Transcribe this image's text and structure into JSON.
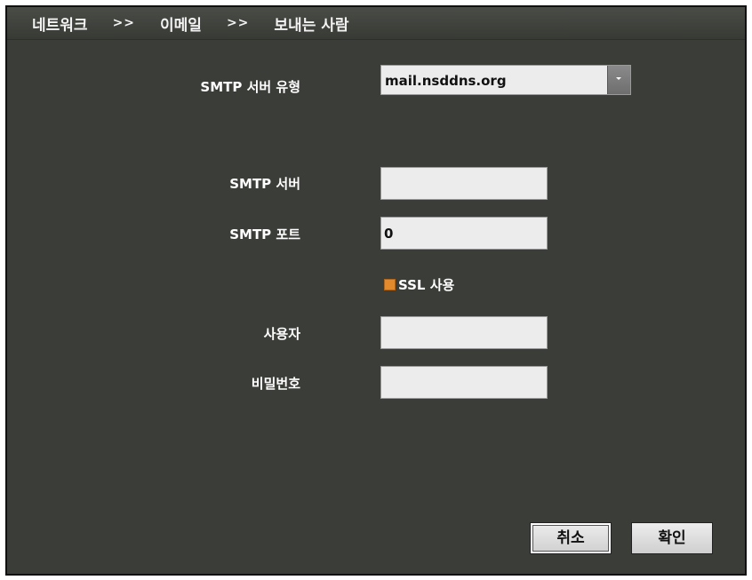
{
  "breadcrumb": {
    "items": [
      "네트워크",
      "이메일",
      "보내는 사람"
    ],
    "separator": ">>"
  },
  "form": {
    "smtp_type_label": "SMTP 서버 유형",
    "smtp_type_value": "mail.nsddns.org",
    "smtp_server_label": "SMTP 서버",
    "smtp_server_value": "",
    "smtp_port_label": "SMTP 포트",
    "smtp_port_value": "0",
    "ssl_label": "SSL 사용",
    "ssl_checked": true,
    "user_label": "사용자",
    "user_value": "",
    "password_label": "비밀번호",
    "password_value": ""
  },
  "buttons": {
    "cancel": "취소",
    "ok": "확인"
  },
  "colors": {
    "background": "#3b3d38",
    "checkbox": "#e28a2c"
  }
}
